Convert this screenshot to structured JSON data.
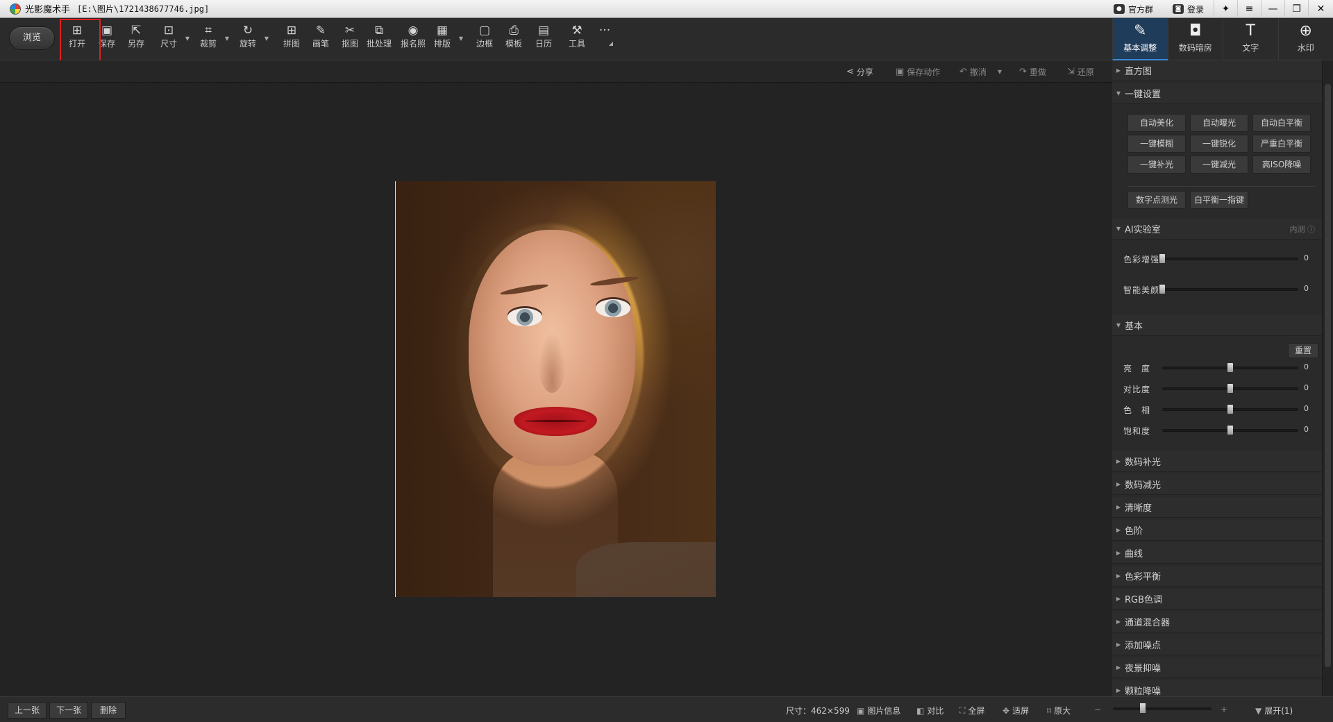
{
  "window": {
    "app_title": "光影魔术手",
    "file_path": "[E:\\图片\\1721438677746.jpg]",
    "links": [
      {
        "label": "官方群",
        "icon": "chat-icon"
      },
      {
        "label": "登录",
        "icon": "user-icon"
      }
    ]
  },
  "toolbar": {
    "browse_label": "浏览",
    "tools": [
      {
        "label": "打开",
        "icon": "open-icon",
        "glyph": "⊞"
      },
      {
        "label": "保存",
        "icon": "save-icon",
        "glyph": "▣"
      },
      {
        "label": "另存",
        "icon": "save-as-icon",
        "glyph": "⇱"
      },
      {
        "label": "尺寸",
        "icon": "resize-icon",
        "glyph": "⊡"
      },
      {
        "label": "裁剪",
        "icon": "crop-icon",
        "glyph": "⌗"
      },
      {
        "label": "旋转",
        "icon": "rotate-icon",
        "glyph": "↻"
      },
      {
        "label": "拼图",
        "icon": "collage-icon",
        "glyph": "⊞"
      },
      {
        "label": "画笔",
        "icon": "brush-icon",
        "glyph": "✎"
      },
      {
        "label": "抠图",
        "icon": "cutout-icon",
        "glyph": "✂"
      },
      {
        "label": "批处理",
        "icon": "batch-icon",
        "glyph": "⧉"
      },
      {
        "label": "报名照",
        "icon": "id-photo-icon",
        "glyph": "◉"
      },
      {
        "label": "排版",
        "icon": "layout-icon",
        "glyph": "▦"
      },
      {
        "label": "边框",
        "icon": "frame-icon",
        "glyph": "▢"
      },
      {
        "label": "模板",
        "icon": "template-icon",
        "glyph": "⎙"
      },
      {
        "label": "日历",
        "icon": "calendar-icon",
        "glyph": "▤"
      },
      {
        "label": "工具",
        "icon": "wrench-icon",
        "glyph": "⚒"
      }
    ],
    "more": "···"
  },
  "right_tabs": [
    {
      "label": "基本调整",
      "icon": "edit-icon",
      "glyph": "✎"
    },
    {
      "label": "数码暗房",
      "icon": "camera-icon",
      "glyph": "◘"
    },
    {
      "label": "文字",
      "icon": "text-icon",
      "glyph": "T"
    },
    {
      "label": "水印",
      "icon": "watermark-icon",
      "glyph": "⊕"
    }
  ],
  "actions": [
    {
      "label": "分享",
      "icon": "share-icon",
      "glyph": "⋖",
      "enabled": true
    },
    {
      "label": "保存动作",
      "icon": "save-action-icon",
      "glyph": "▣",
      "enabled": false
    },
    {
      "label": "撤消",
      "icon": "undo-icon",
      "glyph": "↶",
      "enabled": false
    },
    {
      "label": "重做",
      "icon": "redo-icon",
      "glyph": "↷",
      "enabled": false
    },
    {
      "label": "还原",
      "icon": "restore-icon",
      "glyph": "⇲",
      "enabled": false
    }
  ],
  "panel": {
    "histogram": "直方图",
    "one_click": "一键设置",
    "one_click_buttons": [
      "自动美化",
      "自动曝光",
      "自动白平衡",
      "一键模糊",
      "一键锐化",
      "严重白平衡",
      "一键补光",
      "一键减光",
      "高ISO降噪"
    ],
    "extra_buttons": [
      "数字点测光",
      "白平衡一指键"
    ],
    "ai_lab": "AI实验室",
    "ai_beta": "内测 ⓘ",
    "ai_sliders": [
      {
        "label": "色彩增强",
        "value": "0",
        "level": 0
      },
      {
        "label": "智能美颜",
        "value": "0",
        "level": 0
      }
    ],
    "basic": "基本",
    "reset": "重置",
    "basic_sliders": [
      {
        "label": "亮　度",
        "value": "0",
        "level": 0.5
      },
      {
        "label": "对比度",
        "value": "0",
        "level": 0.5
      },
      {
        "label": "色　相",
        "value": "0",
        "level": 0.5
      },
      {
        "label": "饱和度",
        "value": "0",
        "level": 0.5
      }
    ],
    "collapsed_sections": [
      "数码补光",
      "数码减光",
      "清晰度",
      "色阶",
      "曲线",
      "色彩平衡",
      "RGB色调",
      "通道混合器",
      "添加噪点",
      "夜景抑噪",
      "颗粒降噪"
    ]
  },
  "statusbar": {
    "prev": "上一张",
    "next": "下一张",
    "delete": "删除",
    "size": "尺寸：462×599",
    "info": "图片信息",
    "compare": "对比",
    "fullscreen": "全屏",
    "fit": "适屏",
    "original": "原大",
    "zoom_minus": "−",
    "zoom_plus": "+",
    "expand": "展开(1)"
  }
}
